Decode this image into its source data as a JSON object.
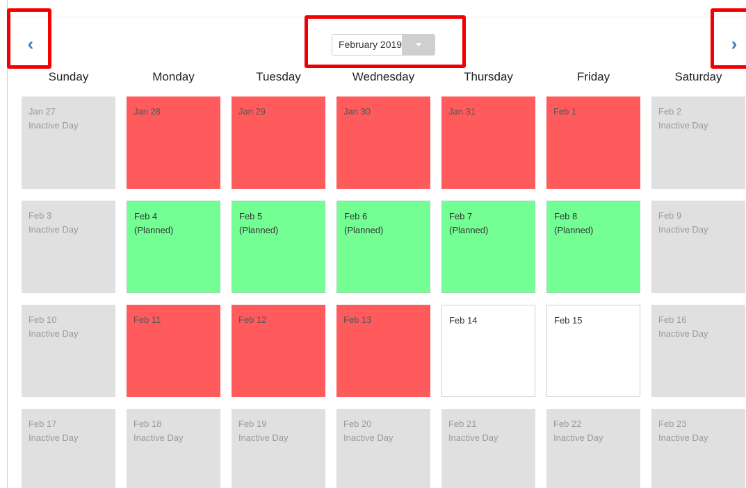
{
  "nav": {
    "prev_glyph": "‹",
    "next_glyph": "›",
    "month_label": "February 2019"
  },
  "colors": {
    "missed": "#ff5a5c",
    "planned": "#73ff94",
    "inactive": "#e0e0e0",
    "open": "#ffffff",
    "arrow": "#3a7fc0",
    "highlight": "#f20000"
  },
  "weekdays": [
    "Sunday",
    "Monday",
    "Tuesday",
    "Wednesday",
    "Thursday",
    "Friday",
    "Saturday"
  ],
  "weeks": [
    [
      {
        "date": "Jan 27",
        "note": "Inactive Day",
        "status": "inactive"
      },
      {
        "date": "Jan 28",
        "note": "",
        "status": "missed"
      },
      {
        "date": "Jan 29",
        "note": "",
        "status": "missed"
      },
      {
        "date": "Jan 30",
        "note": "",
        "status": "missed"
      },
      {
        "date": "Jan 31",
        "note": "",
        "status": "missed"
      },
      {
        "date": "Feb 1",
        "note": "",
        "status": "missed"
      },
      {
        "date": "Feb 2",
        "note": "Inactive Day",
        "status": "inactive"
      }
    ],
    [
      {
        "date": "Feb 3",
        "note": "Inactive Day",
        "status": "inactive"
      },
      {
        "date": "Feb 4",
        "note": "(Planned)",
        "status": "planned"
      },
      {
        "date": "Feb 5",
        "note": "(Planned)",
        "status": "planned"
      },
      {
        "date": "Feb 6",
        "note": "(Planned)",
        "status": "planned"
      },
      {
        "date": "Feb 7",
        "note": "(Planned)",
        "status": "planned"
      },
      {
        "date": "Feb 8",
        "note": "(Planned)",
        "status": "planned"
      },
      {
        "date": "Feb 9",
        "note": "Inactive Day",
        "status": "inactive"
      }
    ],
    [
      {
        "date": "Feb 10",
        "note": "Inactive Day",
        "status": "inactive"
      },
      {
        "date": "Feb 11",
        "note": "",
        "status": "missed"
      },
      {
        "date": "Feb 12",
        "note": "",
        "status": "missed"
      },
      {
        "date": "Feb 13",
        "note": "",
        "status": "missed"
      },
      {
        "date": "Feb 14",
        "note": "",
        "status": "open"
      },
      {
        "date": "Feb 15",
        "note": "",
        "status": "open"
      },
      {
        "date": "Feb 16",
        "note": "Inactive Day",
        "status": "inactive"
      }
    ],
    [
      {
        "date": "Feb 17",
        "note": "Inactive Day",
        "status": "inactive"
      },
      {
        "date": "Feb 18",
        "note": "Inactive Day",
        "status": "inactive"
      },
      {
        "date": "Feb 19",
        "note": "Inactive Day",
        "status": "inactive"
      },
      {
        "date": "Feb 20",
        "note": "Inactive Day",
        "status": "inactive"
      },
      {
        "date": "Feb 21",
        "note": "Inactive Day",
        "status": "inactive"
      },
      {
        "date": "Feb 22",
        "note": "Inactive Day",
        "status": "inactive"
      },
      {
        "date": "Feb 23",
        "note": "Inactive Day",
        "status": "inactive"
      }
    ]
  ]
}
